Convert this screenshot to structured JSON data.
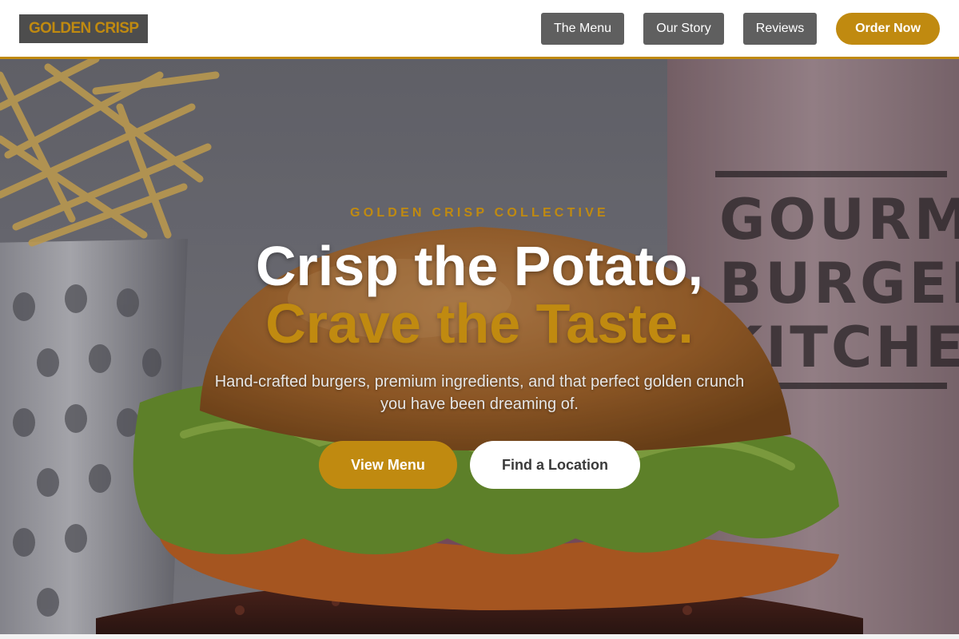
{
  "header": {
    "logo_text": "GOLDEN CRISP",
    "nav": [
      {
        "label": "The Menu"
      },
      {
        "label": "Our Story"
      },
      {
        "label": "Reviews"
      }
    ],
    "order_label": "Order Now"
  },
  "hero": {
    "eyebrow": "GOLDEN CRISP COLLECTIVE",
    "headline_line1": "Crisp the Potato,",
    "headline_line2": "Crave the Taste.",
    "subtext": "Hand-crafted burgers, premium ingredients, and that perfect golden crunch you have been dreaming of.",
    "cta_primary": "View Menu",
    "cta_secondary": "Find a Location",
    "background_image": "burger-and-fries-photo",
    "background_sign_text": [
      "GOURMET",
      "BURGER",
      "KITCHEN"
    ]
  },
  "colors": {
    "accent": "#c08a10",
    "nav_button": "#5f5f5f",
    "logo_background": "#4d4d4d",
    "white": "#ffffff"
  }
}
